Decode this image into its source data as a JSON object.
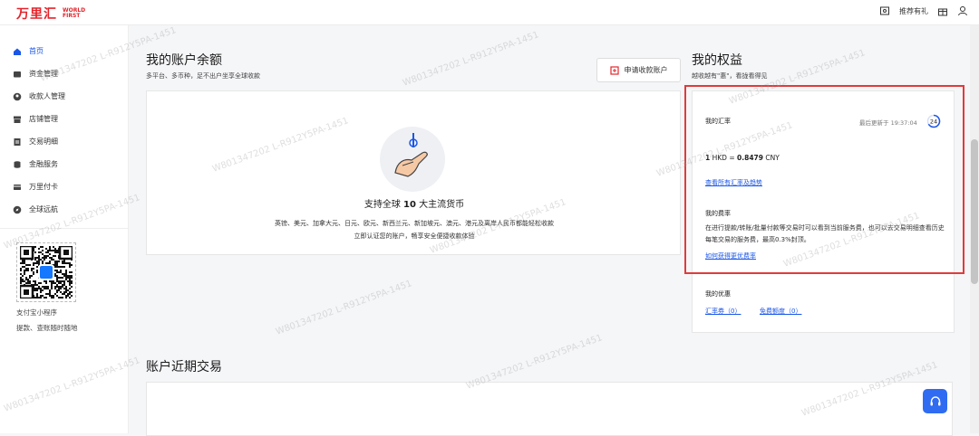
{
  "brand": {
    "cn": "万里汇",
    "en": "WORLD FIRST"
  },
  "topbar": {
    "referral_label": "推荐有礼"
  },
  "sidebar": {
    "items": [
      {
        "label": "首页",
        "icon": "home-icon"
      },
      {
        "label": "资金管理",
        "icon": "wallet-icon"
      },
      {
        "label": "收款人管理",
        "icon": "user-icon"
      },
      {
        "label": "店铺管理",
        "icon": "store-icon"
      },
      {
        "label": "交易明细",
        "icon": "document-icon"
      },
      {
        "label": "金融服务",
        "icon": "coins-icon"
      },
      {
        "label": "万里付卡",
        "icon": "card-icon"
      },
      {
        "label": "全球远航",
        "icon": "compass-icon"
      }
    ],
    "qr_title": "支付宝小程序",
    "qr_desc": "提款、查账随时随地"
  },
  "balance": {
    "title": "我的账户余额",
    "subtitle": "多平台、多币种，足不出户坐享全球收款",
    "apply_button": "申请收款账户",
    "empty_title_prefix": "支持全球",
    "empty_title_count": "10",
    "empty_title_suffix": "大主流货币",
    "empty_desc": "英镑、美元、加拿大元、日元、欧元、新西兰元、新加坡元、澳元、港元及离岸人民币都能轻松收款 立即认证您的账户，畅享安全便捷收款体验"
  },
  "benefits": {
    "title": "我的权益",
    "subtitle": "越收越有\"惠\"，看拢看得见",
    "rate_label": "我的汇率",
    "updated": "最后更新于 19:37:04",
    "refresh_count": "24",
    "rate_amount": "1",
    "rate_from": "HKD",
    "rate_eq": "=",
    "rate_value": "0.8479",
    "rate_to": "CNY",
    "rate_link": "查看所有汇率及趋势",
    "fee_label": "我的费率",
    "fee_desc": "在进行提款/转账/批量付款等交易时可以看到当前服务费，也可以去交易明细查看历史每笔交易的服务费，最高0.3%封顶。",
    "fee_link": "如何获得更优费率",
    "offers_label": "我的优惠",
    "coupon_rate": "汇率券（0）",
    "coupon_free": "免费额度（0）"
  },
  "transactions": {
    "title": "账户近期交易"
  },
  "watermark": "W801347202 L-R912Y5PA-1451",
  "colors": {
    "brand_red": "#e3242b",
    "link_blue": "#1a56e8",
    "highlight_red": "#e03b3b"
  }
}
